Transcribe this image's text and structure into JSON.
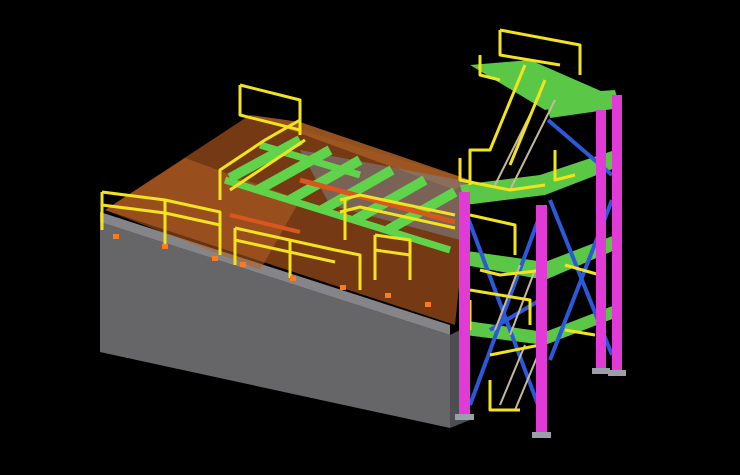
{
  "scene": {
    "subject": "steel-structure-model",
    "background_color": "#000000",
    "colors": {
      "concrete_side": "#6b6b6e",
      "concrete_top": "#8a8a8c",
      "deck_orange": "#b5561f",
      "deck_brown": "#7a3c14",
      "beam_green": "#5fd34a",
      "beam_orange": "#d9561c",
      "handrail_yellow": "#f2e31d",
      "column_magenta": "#e23ad6",
      "brace_blue": "#2b59d9",
      "stair_tan": "#c8b89a",
      "base_plate": "#9aa0aa",
      "bolt_orange": "#ff7a1a"
    },
    "icons": [
      "handrail",
      "column",
      "stair",
      "beam",
      "brace",
      "base-plate"
    ]
  }
}
